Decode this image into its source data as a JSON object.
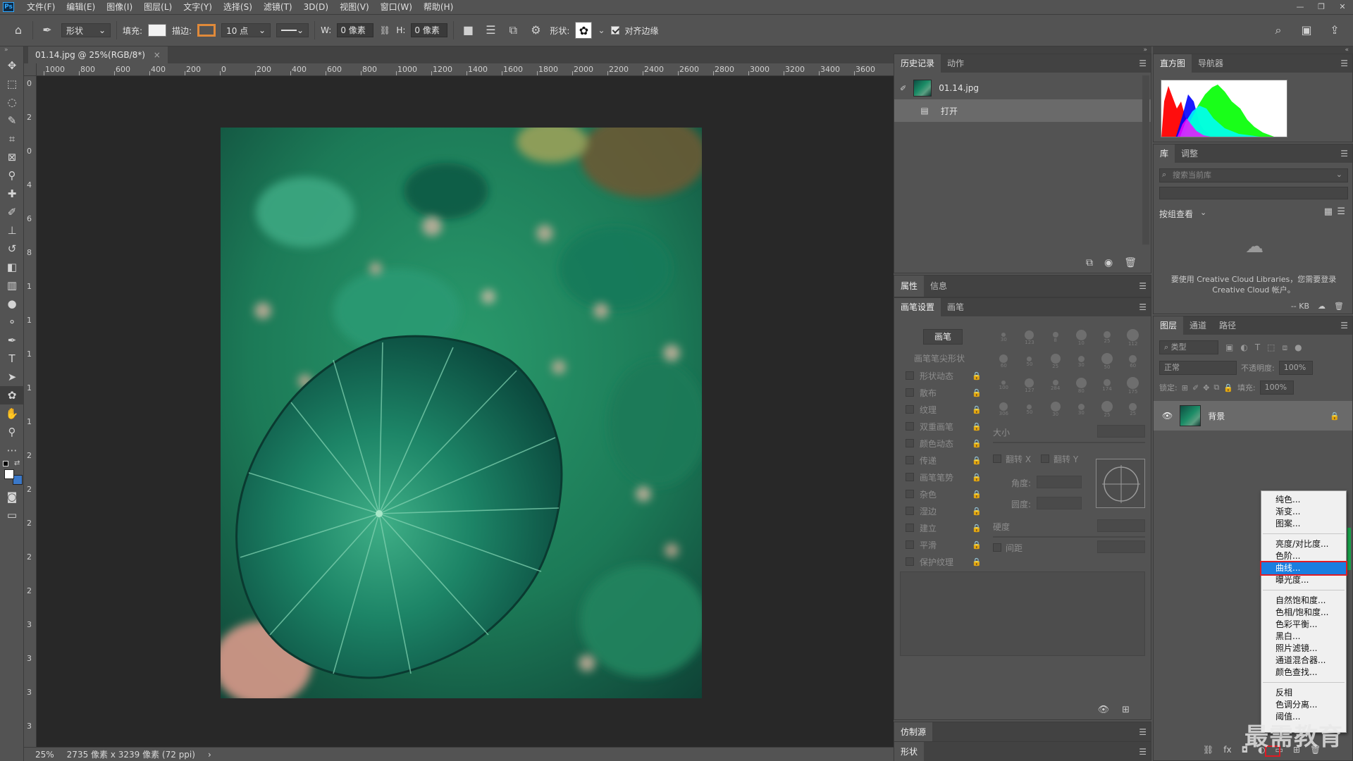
{
  "app": {
    "logo": "Ps",
    "menus": [
      "文件(F)",
      "编辑(E)",
      "图像(I)",
      "图层(L)",
      "文字(Y)",
      "选择(S)",
      "滤镜(T)",
      "3D(D)",
      "视图(V)",
      "窗口(W)",
      "帮助(H)"
    ],
    "window_controls": [
      "—",
      "❐",
      "✕"
    ]
  },
  "options_bar": {
    "mode_select": "形状",
    "fill_label": "填充:",
    "stroke_label": "描边:",
    "stroke_width": "10 点",
    "w_label": "W:",
    "w_value": "0 像素",
    "h_label": "H:",
    "h_value": "0 像素",
    "shape_label": "形状:",
    "align_edges_label": "对齐边缘",
    "align_edges_checked": true,
    "fill_color": "#f2f2f2",
    "stroke_color": "#e08a3a"
  },
  "document": {
    "tab_title": "01.14.jpg @ 25%(RGB/8*)",
    "ruler_top": [
      "1000",
      "800",
      "600",
      "400",
      "200",
      "0",
      "200",
      "400",
      "600",
      "800",
      "1000",
      "1200",
      "1400",
      "1600",
      "1800",
      "2000",
      "2200",
      "2400",
      "2600",
      "2800",
      "3000",
      "3200",
      "3400",
      "3600"
    ],
    "ruler_left": [
      "0",
      "2",
      "0",
      "4",
      "6",
      "8",
      "1",
      "1",
      "1",
      "1",
      "1",
      "2",
      "2",
      "2",
      "2",
      "2",
      "3",
      "3",
      "3",
      "3"
    ],
    "zoom": "25%",
    "dimensions": "2735 像素 x 3239 像素 (72 ppi)"
  },
  "history_panel": {
    "tabs": [
      "历史记录",
      "动作"
    ],
    "snapshot": "01.14.jpg",
    "steps": [
      "打开"
    ]
  },
  "properties_panel": {
    "tabs": [
      "属性",
      "信息"
    ]
  },
  "brush_panel": {
    "tabs": [
      "画笔设置",
      "画笔"
    ],
    "brush_button": "画笔",
    "tip_shape": "画笔笔尖形状",
    "options": [
      "形状动态",
      "散布",
      "纹理",
      "双重画笔",
      "颜色动态",
      "传递",
      "画笔笔势",
      "杂色",
      "湿边",
      "建立",
      "平滑",
      "保护纹理"
    ],
    "tip_sizes": [
      "30",
      "123",
      "8",
      "10",
      "25",
      "112",
      "60",
      "50",
      "25",
      "30",
      "50",
      "60",
      "100",
      "127",
      "284",
      "80",
      "174",
      "175",
      "306",
      "50",
      "30",
      "30",
      "25",
      "25"
    ],
    "size_label": "大小",
    "flip_x": "翻转 X",
    "flip_y": "翻转 Y",
    "angle_label": "角度:",
    "roundness_label": "圆度:",
    "hardness_label": "硬度",
    "spacing_label": "间距"
  },
  "clone_panel": {
    "title": "仿制源"
  },
  "shape_panel": {
    "title": "形状"
  },
  "histogram_panel": {
    "tabs": [
      "直方图",
      "导航器"
    ]
  },
  "library_panel": {
    "tabs": [
      "库",
      "调整"
    ],
    "search_placeholder": "搜索当前库",
    "view_label": "按组查看",
    "message": "要使用 Creative Cloud Libraries，您需要登录 Creative Cloud 帐户。",
    "size": "-- KB"
  },
  "layers_panel": {
    "tabs": [
      "图层",
      "通道",
      "路径"
    ],
    "filter_label": "类型",
    "blend_mode": "正常",
    "opacity_label": "不透明度:",
    "opacity_value": "100%",
    "lock_label": "锁定:",
    "fill_label": "填充:",
    "fill_value": "100%",
    "layers": [
      {
        "name": "背景",
        "visible": true,
        "locked": true
      }
    ]
  },
  "adjustment_menu": {
    "groups": [
      [
        "纯色...",
        "渐变...",
        "图案..."
      ],
      [
        "亮度/对比度...",
        "色阶...",
        "曲线...",
        "曝光度..."
      ],
      [
        "自然饱和度...",
        "色相/饱和度...",
        "色彩平衡...",
        "黑白...",
        "照片滤镜...",
        "通道混合器...",
        "颜色查找..."
      ],
      [
        "反相",
        "色调分离...",
        "阈值..."
      ]
    ],
    "highlighted": "曲线..."
  },
  "watermark": "最需教育"
}
